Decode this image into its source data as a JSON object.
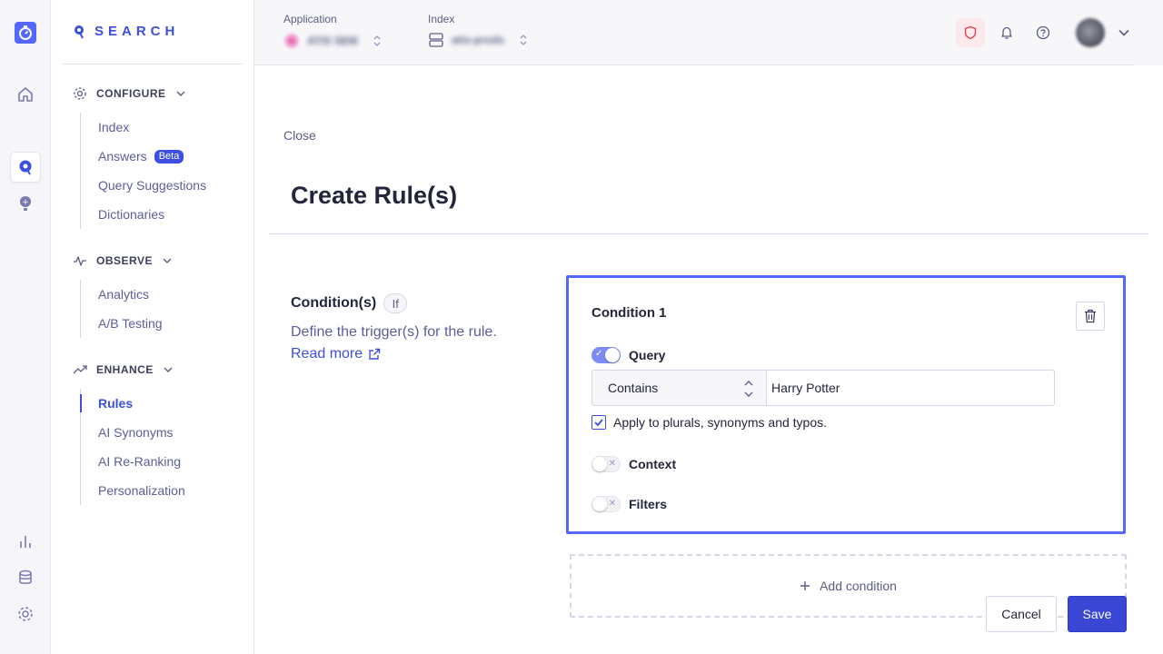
{
  "brand": {
    "name": "SEARCH"
  },
  "topbar": {
    "application_label": "Application",
    "application_value": "ATIS SEM",
    "index_label": "Index",
    "index_value": "atis-prods"
  },
  "sidebar": {
    "sections": [
      {
        "title": "CONFIGURE",
        "items": [
          {
            "label": "Index"
          },
          {
            "label": "Answers",
            "badge": "Beta"
          },
          {
            "label": "Query Suggestions"
          },
          {
            "label": "Dictionaries"
          }
        ]
      },
      {
        "title": "OBSERVE",
        "items": [
          {
            "label": "Analytics"
          },
          {
            "label": "A/B Testing"
          }
        ]
      },
      {
        "title": "ENHANCE",
        "items": [
          {
            "label": "Rules",
            "active": true
          },
          {
            "label": "AI Synonyms"
          },
          {
            "label": "AI Re-Ranking"
          },
          {
            "label": "Personalization"
          }
        ]
      }
    ]
  },
  "main": {
    "close_label": "Close",
    "title": "Create Rule(s)",
    "conditions": {
      "heading": "Condition(s)",
      "chip": "If",
      "description": "Define the trigger(s) for the rule.",
      "read_more": "Read more"
    },
    "condition_card": {
      "title": "Condition 1",
      "query_toggle_label": "Query",
      "query_toggle_on": true,
      "operator_value": "Contains",
      "query_value": "Harry Potter",
      "apply_checkbox_label": "Apply to plurals, synonyms and typos.",
      "apply_checked": true,
      "context_toggle_label": "Context",
      "context_toggle_on": false,
      "filters_toggle_label": "Filters",
      "filters_toggle_on": false
    },
    "add_condition_label": "Add condition",
    "cancel_label": "Cancel",
    "save_label": "Save"
  },
  "colors": {
    "accent": "#3c4fe0",
    "card_border": "#5468ff",
    "save_button": "#3a46d4"
  }
}
